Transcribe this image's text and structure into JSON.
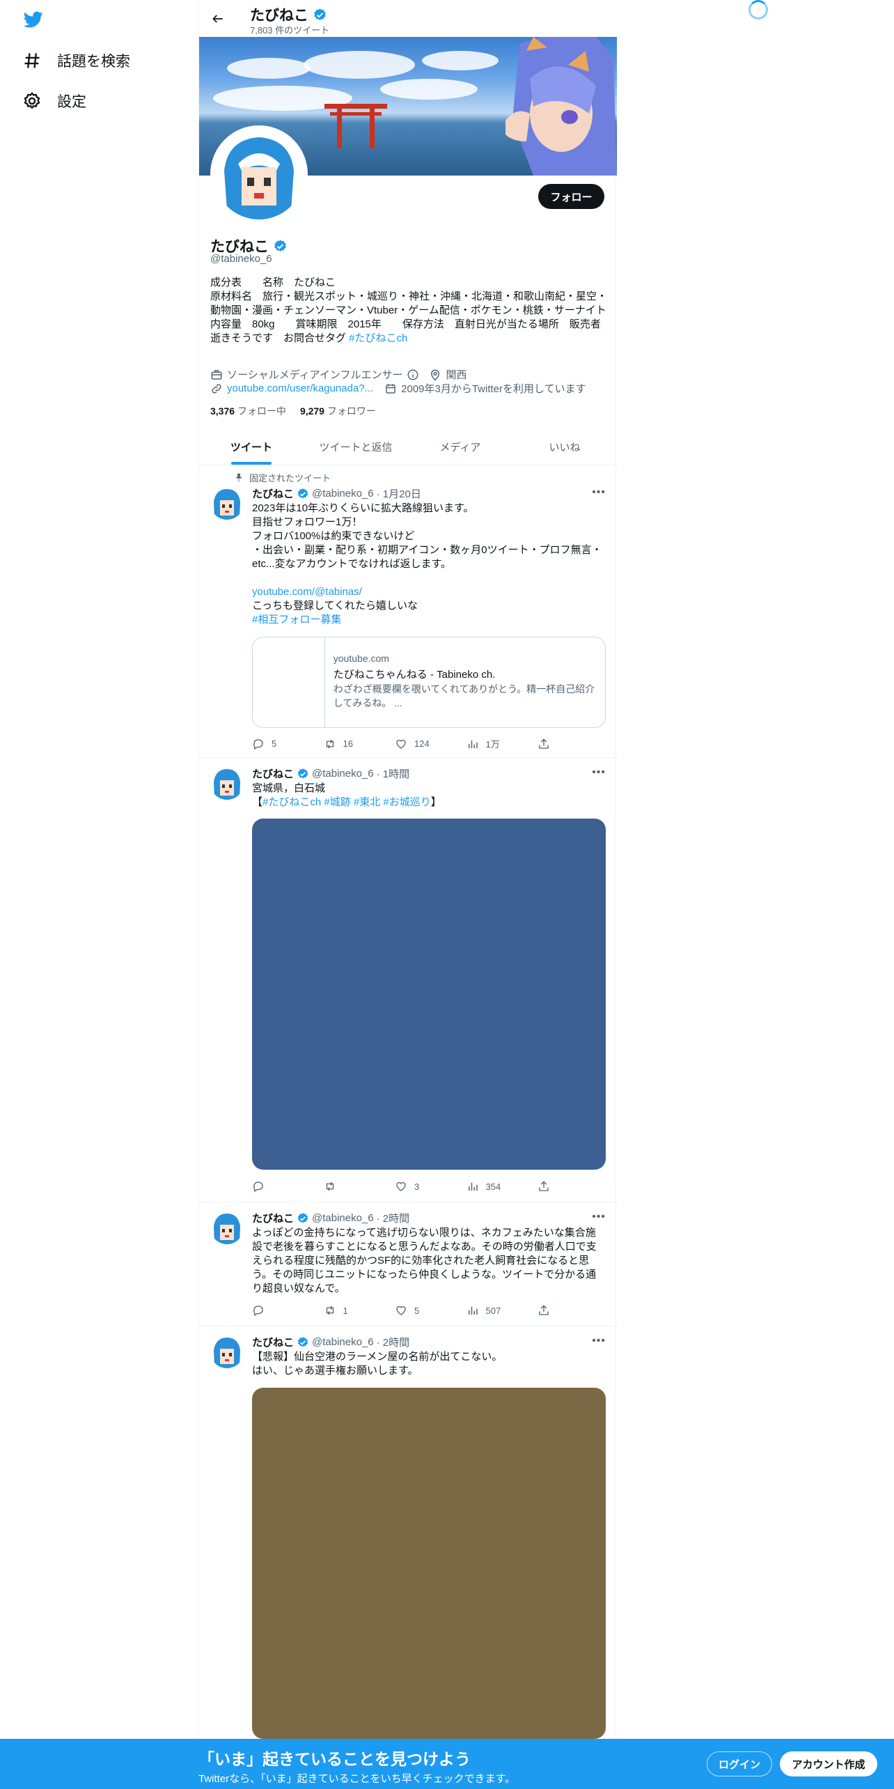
{
  "sidebar": {
    "items": [
      {
        "label": "話題を検索",
        "icon": "hashtag-icon"
      },
      {
        "label": "設定",
        "icon": "gear-icon"
      }
    ]
  },
  "header": {
    "name": "たびねこ",
    "tweet_count": "7,803 件のツイート"
  },
  "profile": {
    "name": "たびねこ",
    "handle": "@tabineko_6",
    "follow_label": "フォロー",
    "bio": "成分表　　名称　たびねこ\n原材料名　旅行・観光スポット・城巡り・神社・沖縄・北海道・和歌山南紀・星空・動物園・漫画・チェンソーマン・Vtuber・ゲーム配信・ポケモン・桃鉄・サーナイト\n内容量　80kg　　賞味期限　2015年　　保存方法　直射日光が当たる場所　販売者　逝きそうです　お問合せタグ ",
    "bio_tag": "#たびねこch",
    "category": "ソーシャルメディアインフルエンサー",
    "location": "関西",
    "url": "youtube.com/user/kagunada?...",
    "joined": "2009年3月からTwitterを利用しています",
    "following_count": "3,376",
    "following_label": "フォロー中",
    "followers_count": "9,279",
    "followers_label": "フォロワー"
  },
  "tabs": [
    "ツイート",
    "ツイートと返信",
    "メディア",
    "いいね"
  ],
  "tweets": [
    {
      "pinned": "固定されたツイート",
      "name": "たびねこ",
      "handle": "@tabineko_6",
      "time": "· 1月20日",
      "text1": "2023年は10年ぶりくらいに拡大路線狙います。\n目指せフォロワー1万！\nフォロバ100%は約束できないけど\n・出会い・副業・配り系・初期アイコン・数ヶ月0ツイート・プロフ無言・etc...変なアカウントでなければ返します。\n",
      "link": "youtube.com/@tabinas/",
      "text2": "こっちも登録してくれたら嬉しいな",
      "tag": "#相互フォロー募集",
      "card": {
        "domain": "youtube.com",
        "title": "たびねこちゃんねる - Tabineko ch.",
        "desc": "わざわざ概要欄を覗いてくれてありがとう。精一杯自己紹介してみるね。 ..."
      },
      "replies": "5",
      "retweets": "16",
      "likes": "124",
      "views": "1万"
    },
    {
      "name": "たびねこ",
      "handle": "@tabineko_6",
      "time": "· 1時間",
      "text1": "宮城県，白石城",
      "tags_prefix": "【",
      "tags": "#たびねこch #城跡 #東北 #お城巡り",
      "tags_suffix": "】",
      "media_color": "#3d5f91",
      "replies": "",
      "retweets": "",
      "likes": "3",
      "views": "354"
    },
    {
      "name": "たびねこ",
      "handle": "@tabineko_6",
      "time": "· 2時間",
      "text1": "よっぽどの金持ちになって逃げ切らない限りは、ネカフェみたいな集合施設で老後を暮らすことになると思うんだよなあ。その時の労働者人口で支えられる程度に残酷的かつSF的に効率化された老人飼育社会になると思う。その時同じユニットになったら仲良くしような。ツイートで分かる通り超良い奴なんで。",
      "replies": "",
      "retweets": "1",
      "likes": "5",
      "views": "507"
    },
    {
      "name": "たびねこ",
      "handle": "@tabineko_6",
      "time": "· 2時間",
      "text1": "【悲報】仙台空港のラーメン屋の名前が出てこない。\nはい、じゃあ選手権お願いします。",
      "media_color": "#7a6845"
    }
  ],
  "bottom_bar": {
    "title": "「いま」起きていることを見つけよう",
    "subtitle": "Twitterなら、「いま」起きていることをいち早くチェックできます。",
    "login": "ログイン",
    "signup": "アカウント作成"
  },
  "colors": {
    "accent": "#1d9bf0",
    "text": "#0f1419",
    "muted": "#536471"
  }
}
